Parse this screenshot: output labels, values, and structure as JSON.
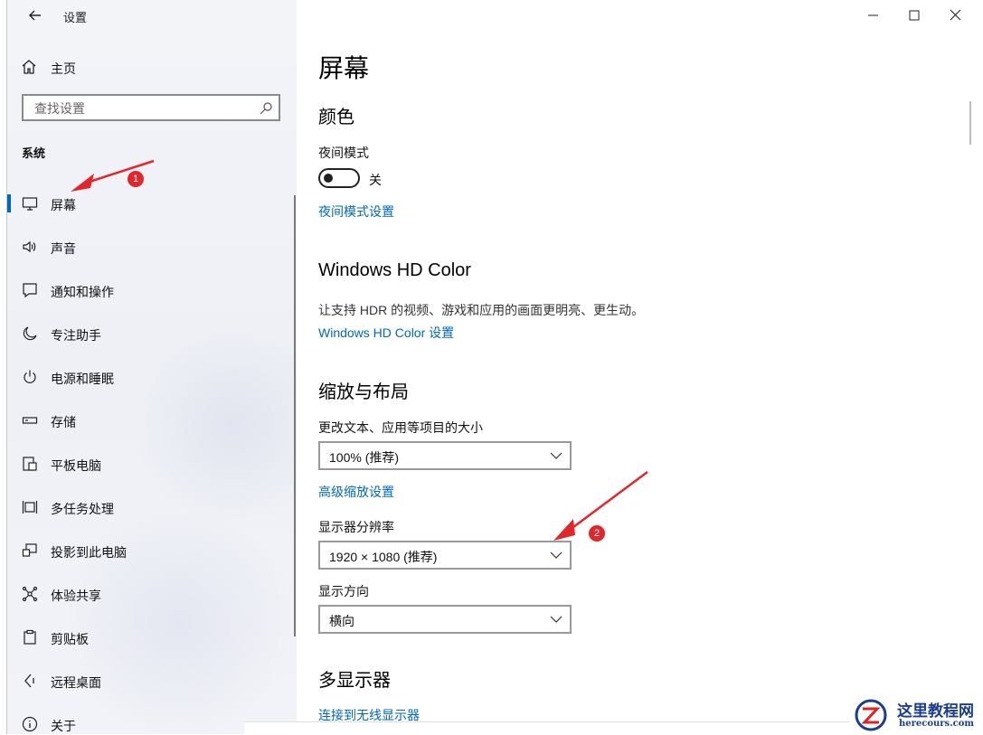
{
  "window": {
    "title": "设置",
    "back_icon": "arrow-left-icon",
    "controls": [
      "minimize-icon",
      "maximize-icon",
      "close-icon"
    ]
  },
  "sidebar": {
    "home_label": "主页",
    "search_placeholder": "查找设置",
    "section_label": "系统",
    "items": [
      {
        "label": "屏幕",
        "icon": "monitor-icon",
        "active": true
      },
      {
        "label": "声音",
        "icon": "speaker-icon"
      },
      {
        "label": "通知和操作",
        "icon": "notification-icon"
      },
      {
        "label": "专注助手",
        "icon": "moon-icon"
      },
      {
        "label": "电源和睡眠",
        "icon": "power-icon"
      },
      {
        "label": "存储",
        "icon": "storage-icon"
      },
      {
        "label": "平板电脑",
        "icon": "tablet-icon"
      },
      {
        "label": "多任务处理",
        "icon": "multitask-icon"
      },
      {
        "label": "投影到此电脑",
        "icon": "project-icon"
      },
      {
        "label": "体验共享",
        "icon": "share-icon"
      },
      {
        "label": "剪贴板",
        "icon": "clipboard-icon"
      },
      {
        "label": "远程桌面",
        "icon": "remote-desktop-icon"
      },
      {
        "label": "关于",
        "icon": "info-icon"
      }
    ]
  },
  "main": {
    "page_title": "屏幕",
    "color_section": {
      "heading": "颜色",
      "night_mode_label": "夜间模式",
      "night_mode_state": "关",
      "night_mode_link": "夜间模式设置"
    },
    "hdr_section": {
      "heading": "Windows HD Color",
      "description": "让支持 HDR 的视频、游戏和应用的画面更明亮、更生动。",
      "link": "Windows HD Color 设置"
    },
    "scale_section": {
      "heading": "缩放与布局",
      "scale_label": "更改文本、应用等项目的大小",
      "scale_value": "100% (推荐)",
      "advanced_link": "高级缩放设置",
      "resolution_label": "显示器分辨率",
      "resolution_value": "1920 × 1080 (推荐)",
      "orientation_label": "显示方向",
      "orientation_value": "横向"
    },
    "multi_section": {
      "heading": "多显示器",
      "wireless_link": "连接到无线显示器"
    }
  },
  "annotations": {
    "badge_1": "1",
    "badge_2": "2",
    "color": "#e0282c"
  },
  "watermark": {
    "cn": "这里教程网",
    "en": "herecours.com"
  },
  "colors": {
    "accent": "#0067c0",
    "sidebar_bg": "#f0f1f6"
  }
}
